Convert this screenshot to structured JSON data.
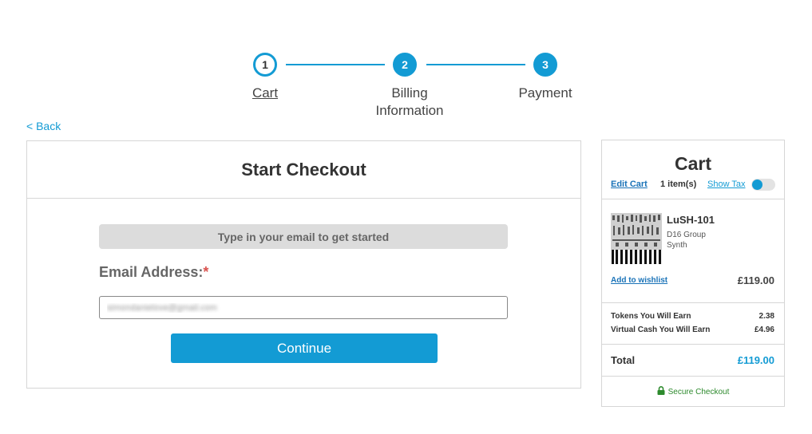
{
  "stepper": {
    "steps": [
      {
        "number": "1",
        "label": "Cart"
      },
      {
        "number": "2",
        "label_line1": "Billing",
        "label_line2": "Information"
      },
      {
        "number": "3",
        "label": "Payment"
      }
    ]
  },
  "nav": {
    "back_label": "< Back"
  },
  "checkout": {
    "title": "Start Checkout",
    "prompt": "Type in your email to get started",
    "email_label": "Email Address:",
    "required_mark": "*",
    "email_value": "simondanielove@gmail.com",
    "continue_label": "Continue"
  },
  "cart": {
    "title": "Cart",
    "edit_label": "Edit Cart",
    "item_count": "1 item(s)",
    "show_tax_label": "Show Tax",
    "show_tax_on": true,
    "item": {
      "name": "LuSH-101",
      "brand": "D16 Group",
      "category": "Synth",
      "wishlist_label": "Add to wishlist",
      "price": "£119.00"
    },
    "earnings": [
      {
        "label": "Tokens You Will Earn",
        "value": "2.38"
      },
      {
        "label": "Virtual Cash You Will Earn",
        "value": "£4.96"
      }
    ],
    "total_label": "Total",
    "total_value": "£119.00",
    "secure_label": "Secure Checkout"
  },
  "colors": {
    "accent": "#139bd4",
    "secure": "#2d8a2d",
    "required": "#d9534f"
  }
}
